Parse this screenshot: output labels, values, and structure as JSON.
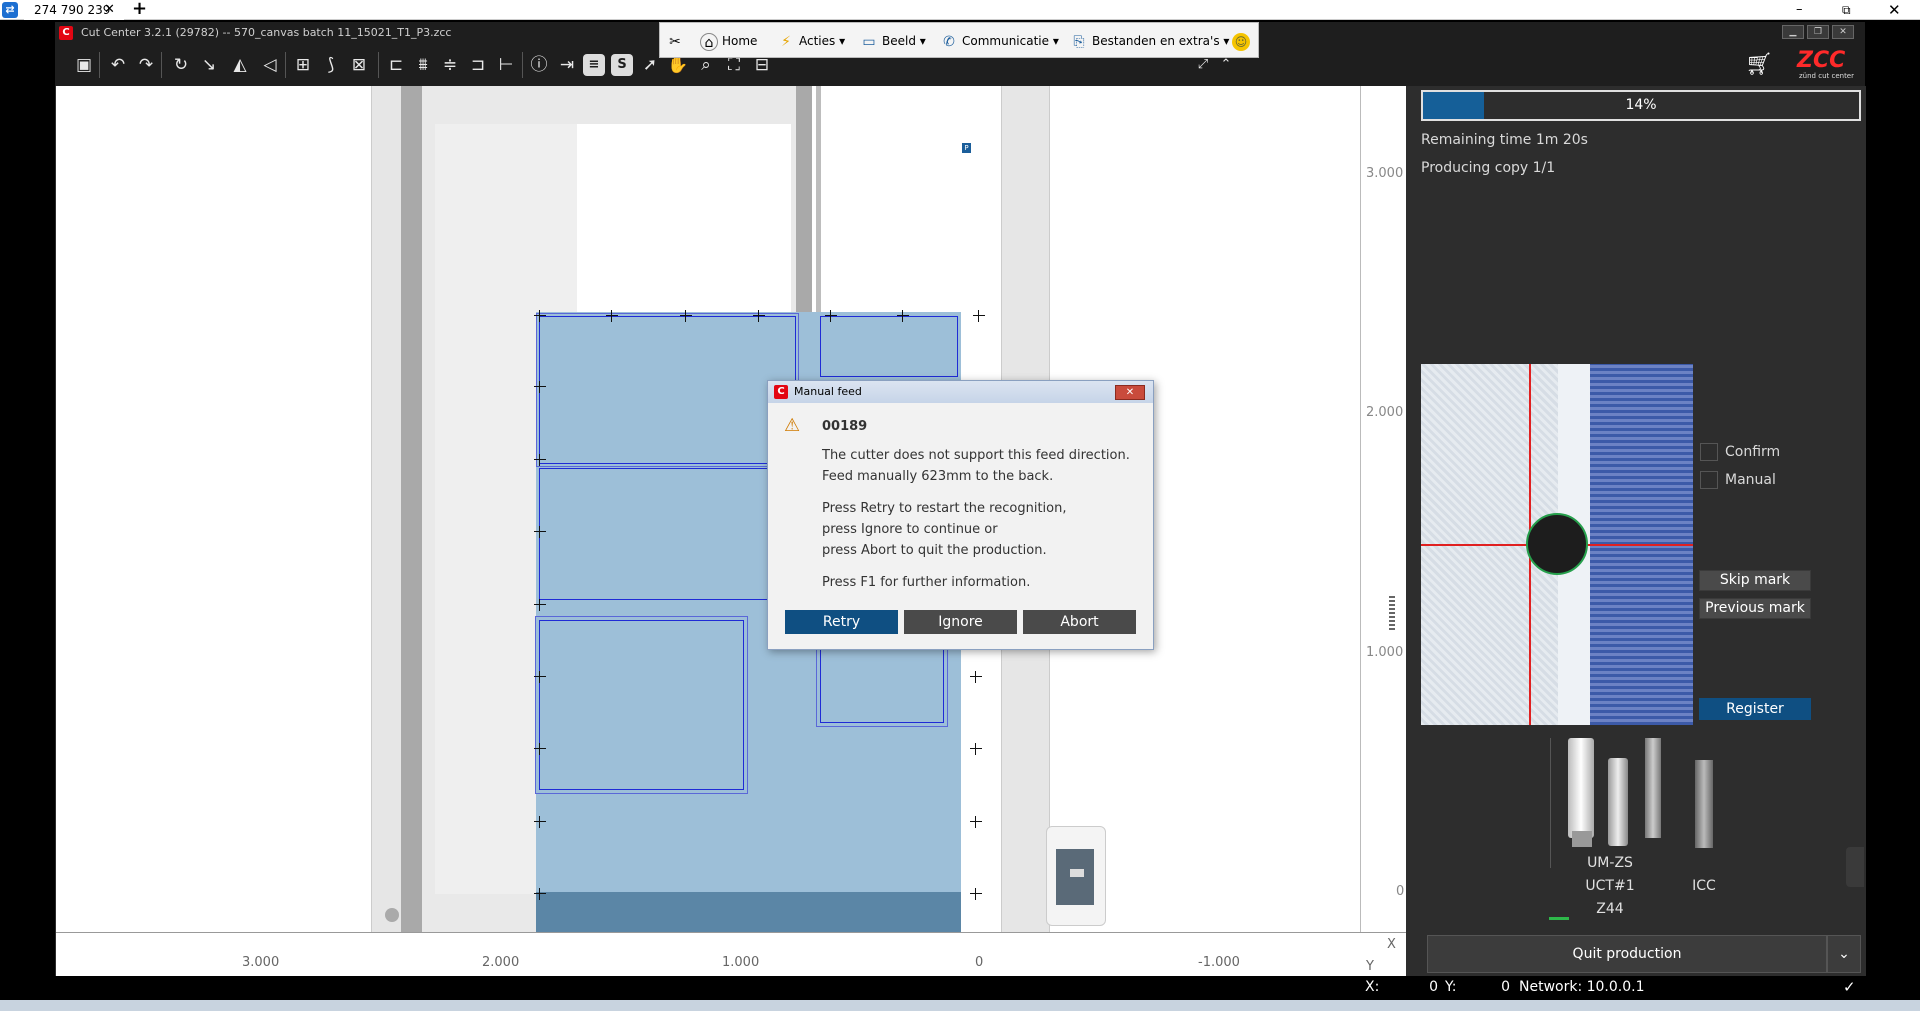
{
  "teamviewer": {
    "tab_label": "274 790 239",
    "close_glyph": "✕",
    "new_tab_glyph": "+",
    "minimize_glyph": "–",
    "restore_glyph": "⧉",
    "close_window_glyph": "✕"
  },
  "app": {
    "title": "Cut Center 3.2.1 (29782)  --  570_canvas batch 11_15021_T1_P3.zcc",
    "logo_letter": "C"
  },
  "quick_menu": {
    "home": "Home",
    "acties": "Acties",
    "beeld": "Beeld",
    "communicatie": "Communicatie",
    "bestanden": "Bestanden en extra's"
  },
  "ruler": {
    "x_labels": [
      "3.000",
      "2.000",
      "1.000",
      "0",
      "-1.000"
    ],
    "y_labels": [
      "3.000",
      "2.000",
      "1.000",
      "0"
    ],
    "x_axis": "X",
    "y_axis": "Y"
  },
  "status": {
    "x_label": "X:",
    "x_value": "0",
    "y_label": "Y:",
    "y_value": "0",
    "network": "Network: 10.0.0.1"
  },
  "panel": {
    "brand": "ZCC",
    "brand_sub": "zünd cut center",
    "progress_percent": 14,
    "progress_label": "14%",
    "remaining": "Remaining time 1m 20s",
    "producing": "Producing copy 1/1",
    "confirm_label": "Confirm",
    "manual_label": "Manual",
    "skip_mark": "Skip mark",
    "previous_mark": "Previous mark",
    "register": "Register",
    "tool_names": [
      "UM-ZS",
      "UCT#1",
      "Z44"
    ],
    "icc_label": "ICC",
    "quit": "Quit production"
  },
  "dialog": {
    "title": "Manual feed",
    "code": "00189",
    "line1": "The cutter does not support this feed direction.",
    "line2": "Feed manually 623mm to the back.",
    "line3": "Press Retry to restart the recognition,",
    "line4": "press Ignore to continue or",
    "line5": "press Abort to quit the production.",
    "line6": "Press F1 for further information.",
    "retry": "Retry",
    "ignore": "Ignore",
    "abort": "Abort"
  },
  "colors": {
    "accent": "#155f98",
    "job_fill": "#9dbfd8",
    "crosshair": "#e02020"
  }
}
